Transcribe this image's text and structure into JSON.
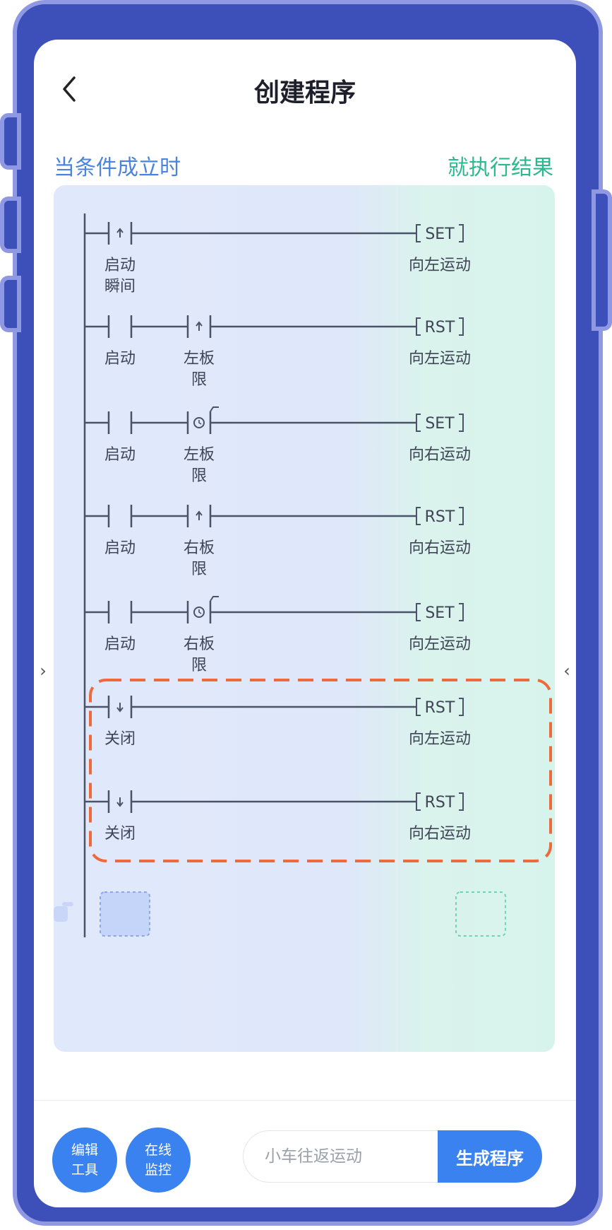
{
  "header": {
    "title": "创建程序"
  },
  "labels": {
    "condition": "当条件成立时",
    "result": "就执行结果"
  },
  "rungs": [
    {
      "contacts": [
        {
          "type": "rising",
          "label_lines": [
            "启动",
            "瞬间"
          ]
        }
      ],
      "coil": {
        "op": "SET",
        "label": "向左运动"
      }
    },
    {
      "contacts": [
        {
          "type": "no",
          "label_lines": [
            "启动"
          ]
        },
        {
          "type": "rising",
          "label_lines": [
            "左板",
            "限"
          ]
        }
      ],
      "coil": {
        "op": "RST",
        "label": "向左运动"
      }
    },
    {
      "contacts": [
        {
          "type": "no",
          "label_lines": [
            "启动"
          ]
        },
        {
          "type": "timer",
          "label_lines": [
            "左板",
            "限"
          ]
        }
      ],
      "coil": {
        "op": "SET",
        "label": "向右运动"
      }
    },
    {
      "contacts": [
        {
          "type": "no",
          "label_lines": [
            "启动"
          ]
        },
        {
          "type": "rising",
          "label_lines": [
            "右板",
            "限"
          ]
        }
      ],
      "coil": {
        "op": "RST",
        "label": "向右运动"
      }
    },
    {
      "contacts": [
        {
          "type": "no",
          "label_lines": [
            "启动"
          ]
        },
        {
          "type": "timer",
          "label_lines": [
            "右板",
            "限"
          ]
        }
      ],
      "coil": {
        "op": "SET",
        "label": "向左运动"
      }
    },
    {
      "contacts": [
        {
          "type": "falling",
          "label_lines": [
            "关闭"
          ]
        }
      ],
      "coil": {
        "op": "RST",
        "label": "向左运动"
      }
    },
    {
      "contacts": [
        {
          "type": "falling",
          "label_lines": [
            "关闭"
          ]
        }
      ],
      "coil": {
        "op": "RST",
        "label": "向右运动"
      }
    }
  ],
  "footer": {
    "edit_tools_lines": [
      "编辑",
      "工具"
    ],
    "online_monitor_lines": [
      "在线",
      "监控"
    ],
    "program_name_placeholder": "小车往返运动",
    "generate_label": "生成程序"
  },
  "colors": {
    "condition": "#4a84de",
    "result": "#2cb98c",
    "highlight": "#ee6a3c",
    "accent": "#3a82f0",
    "frame": "#3d4fb8"
  },
  "icons": {
    "back": "chevron-left-icon",
    "prev": "chevron-right-icon",
    "next": "chevron-left-icon",
    "drag": "hand-pointer-icon"
  }
}
